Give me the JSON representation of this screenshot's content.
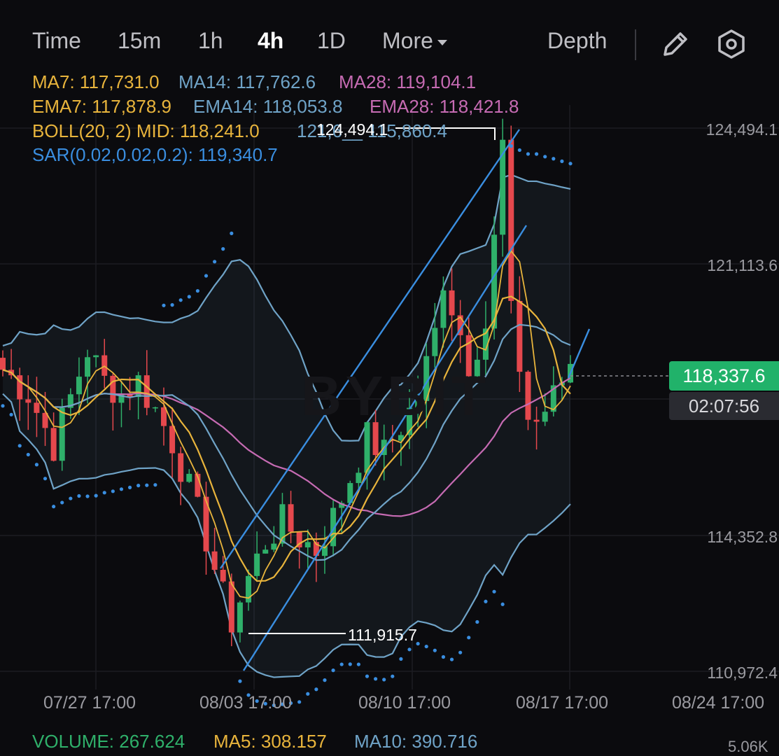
{
  "toolbar": {
    "tabs": [
      "Time",
      "15m",
      "1h",
      "4h",
      "1D",
      "More"
    ],
    "active_tab": "4h",
    "depth_label": "Depth",
    "icons": [
      "pencil-icon",
      "hexagon-settings-icon"
    ]
  },
  "indicators": {
    "ma7": "MA7: 117,731.0",
    "ma14": "MA14: 117,762.6",
    "ma28": "MA28: 119,104.1",
    "ema7": "EMA7: 117,878.9",
    "ema14": "EMA14: 118,053.8",
    "ema28": "EMA28: 118,421.8",
    "boll": "BOLL(20, 2) MID: 118,241.0",
    "boll_bands": "121,6__  115,860.4",
    "sar": "SAR(0.02,0.02,0.2): 119,340.7"
  },
  "colors": {
    "ma7": "#e8b43c",
    "ma14": "#6fa3c7",
    "ma28": "#c66bb3",
    "boll": "#e8b43c",
    "sar": "#3a8ee0",
    "up": "#2fb06a",
    "down": "#e5484d",
    "band": "#6fa3c7",
    "trend": "#3a8ee0",
    "volume": "#2fb06a"
  },
  "chart_data": {
    "type": "candlestick",
    "y_ticks": [
      "124,494.1",
      "121,113.6",
      "114,352.8",
      "110,972.4"
    ],
    "x_ticks": [
      "07/27 17:00",
      "08/03 17:00",
      "08/10 17:00",
      "08/17 17:00",
      "08/24 17:00"
    ],
    "ylim": [
      110300,
      124800
    ],
    "last_price": "118,337.6",
    "countdown": "02:07:56",
    "high_marker": "124,494.1",
    "low_marker": "111,915.7",
    "price_path": [
      [
        0,
        118200
      ],
      [
        3,
        117600
      ],
      [
        6,
        116300
      ],
      [
        8,
        117500
      ],
      [
        10,
        118700
      ],
      [
        12,
        117900
      ],
      [
        14,
        117600
      ],
      [
        16,
        117900
      ],
      [
        18,
        117200
      ],
      [
        20,
        116400
      ],
      [
        22,
        115200
      ],
      [
        24,
        114000
      ],
      [
        26,
        112500
      ],
      [
        27,
        111915.7
      ],
      [
        29,
        113000
      ],
      [
        31,
        113900
      ],
      [
        33,
        114400
      ],
      [
        35,
        114000
      ],
      [
        37,
        113700
      ],
      [
        39,
        114500
      ],
      [
        41,
        115500
      ],
      [
        43,
        116500
      ],
      [
        45,
        116100
      ],
      [
        47,
        116800
      ],
      [
        49,
        117500
      ],
      [
        51,
        119100
      ],
      [
        52,
        120500
      ],
      [
        53,
        119800
      ],
      [
        55,
        118400
      ],
      [
        57,
        119300
      ],
      [
        58,
        121400
      ],
      [
        59,
        123800
      ],
      [
        60,
        119500
      ],
      [
        61,
        118300
      ],
      [
        62,
        117000
      ],
      [
        63,
        116900
      ],
      [
        65,
        117500
      ],
      [
        67,
        118337.6
      ]
    ],
    "watermark": "BYBIT"
  },
  "volume": {
    "vol": "VOLUME: 267.624",
    "ma5": "MA5: 308.157",
    "ma10": "MA10: 390.716",
    "scale": "5.06K"
  }
}
